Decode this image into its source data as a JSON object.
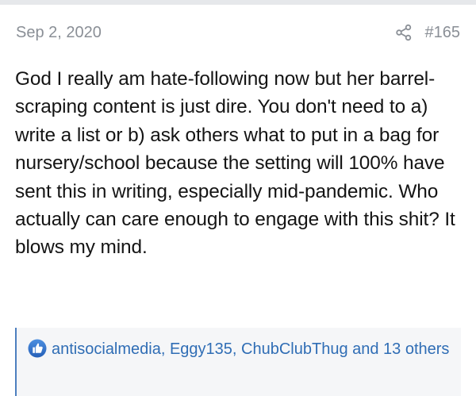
{
  "post": {
    "date": "Sep 2, 2020",
    "number": "#165",
    "share_icon": "share-icon",
    "body": "God I really am hate-following now but her barrel-scraping content is just dire. You don't need to a) write a list or b) ask others what to put in a bag for nursery/school because the setting will 100% have sent this in writing, especially mid-pandemic. Who actually can care enough to engage with this shit? It blows my mind."
  },
  "reactions": {
    "icon": "like-icon",
    "text": "antisocialmedia, Eggy135, ChubClubThug and 13 others"
  },
  "colors": {
    "meta_text": "#8a8f96",
    "body_text": "#141414",
    "link_blue": "#2f6db5",
    "reaction_border": "#4d7fbf",
    "reaction_bg": "#f5f6f8"
  }
}
